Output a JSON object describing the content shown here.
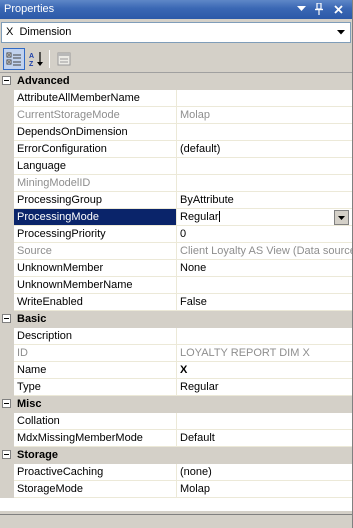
{
  "window": {
    "title": "Properties"
  },
  "selector": {
    "value": "X  Dimension"
  },
  "categories": [
    {
      "label": "Advanced",
      "properties": [
        {
          "name": "AttributeAllMemberName",
          "value": ""
        },
        {
          "name": "CurrentStorageMode",
          "value": "Molap",
          "readonly": true
        },
        {
          "name": "DependsOnDimension",
          "value": ""
        },
        {
          "name": "ErrorConfiguration",
          "value": "(default)"
        },
        {
          "name": "Language",
          "value": ""
        },
        {
          "name": "MiningModelID",
          "value": "",
          "readonly": true
        },
        {
          "name": "ProcessingGroup",
          "value": "ByAttribute"
        },
        {
          "name": "ProcessingMode",
          "value": "Regular",
          "selected": true
        },
        {
          "name": "ProcessingPriority",
          "value": "0"
        },
        {
          "name": "Source",
          "value": "Client Loyalty AS View (Data source",
          "readonly": true
        },
        {
          "name": "UnknownMember",
          "value": "None"
        },
        {
          "name": "UnknownMemberName",
          "value": ""
        },
        {
          "name": "WriteEnabled",
          "value": "False"
        }
      ]
    },
    {
      "label": "Basic",
      "properties": [
        {
          "name": "Description",
          "value": ""
        },
        {
          "name": "ID",
          "value": "LOYALTY REPORT DIM X",
          "readonly": true
        },
        {
          "name": "Name",
          "value": "X",
          "bold": true
        },
        {
          "name": "Type",
          "value": "Regular"
        }
      ]
    },
    {
      "label": "Misc",
      "properties": [
        {
          "name": "Collation",
          "value": ""
        },
        {
          "name": "MdxMissingMemberMode",
          "value": "Default"
        }
      ]
    },
    {
      "label": "Storage",
      "properties": [
        {
          "name": "ProactiveCaching",
          "value": "(none)"
        },
        {
          "name": "StorageMode",
          "value": "Molap"
        }
      ]
    }
  ],
  "colors": {
    "title_bar": "#2c59a8",
    "selection": "#0a246a",
    "panel": "#d4d0c8",
    "readonly_text": "#8e8e8e"
  },
  "icons": {
    "dropdown": "chevron-down-icon",
    "pin": "pin-icon",
    "close": "close-icon",
    "categorized": "categorized-icon",
    "alphabetical": "alphabetical-sort-icon",
    "property_pages": "property-pages-icon"
  }
}
